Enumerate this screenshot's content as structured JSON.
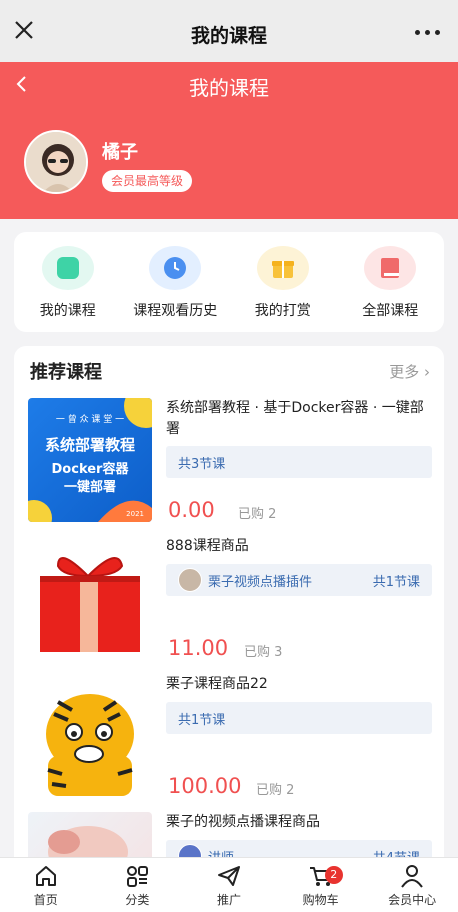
{
  "topbar": {
    "title": "我的课程"
  },
  "header": {
    "title": "我的课程",
    "bg_color": "#f55a5a",
    "user": {
      "name": "橘子",
      "level": "会员最高等级"
    }
  },
  "quick_links": [
    {
      "label": "我的课程",
      "icon": "wallet-icon",
      "color": "#3ed3a6",
      "bg": "#e3f8f1"
    },
    {
      "label": "课程观看历史",
      "icon": "clock-icon",
      "color": "#4a8ff0",
      "bg": "#e3efff"
    },
    {
      "label": "我的打赏",
      "icon": "gift-icon",
      "color": "#f8c23a",
      "bg": "#fdf3d6"
    },
    {
      "label": "全部课程",
      "icon": "book-icon",
      "color": "#f06a6a",
      "bg": "#fde5e5"
    }
  ],
  "recommend": {
    "title": "推荐课程",
    "more": "更多",
    "courses": [
      {
        "name": "系统部署教程 · 基于Docker容器 · 一键部署",
        "lessons": "共3节课",
        "teacher": "",
        "price": "0.00",
        "sold": "已购 2",
        "thumb": {
          "tag": "一 曾 众 课 堂 一",
          "line1": "系统部署教程",
          "line2": "Docker容器",
          "line3": "一键部署",
          "year": "2021"
        }
      },
      {
        "name": "888课程商品",
        "lessons": "共1节课",
        "teacher": "栗子视频点播插件",
        "price": "11.00",
        "sold": "已购 3"
      },
      {
        "name": "栗子课程商品22",
        "lessons": "共1节课",
        "teacher": "",
        "price": "100.00",
        "sold": "已购 2"
      },
      {
        "name": "栗子的视频点播课程商品",
        "lessons": "共4节课",
        "teacher": "讲师",
        "price": "",
        "sold": ""
      }
    ]
  },
  "tabbar": [
    {
      "label": "首页",
      "icon": "home-icon"
    },
    {
      "label": "分类",
      "icon": "category-icon"
    },
    {
      "label": "推广",
      "icon": "send-icon"
    },
    {
      "label": "购物车",
      "icon": "cart-icon",
      "badge": "2"
    },
    {
      "label": "会员中心",
      "icon": "user-icon"
    }
  ]
}
